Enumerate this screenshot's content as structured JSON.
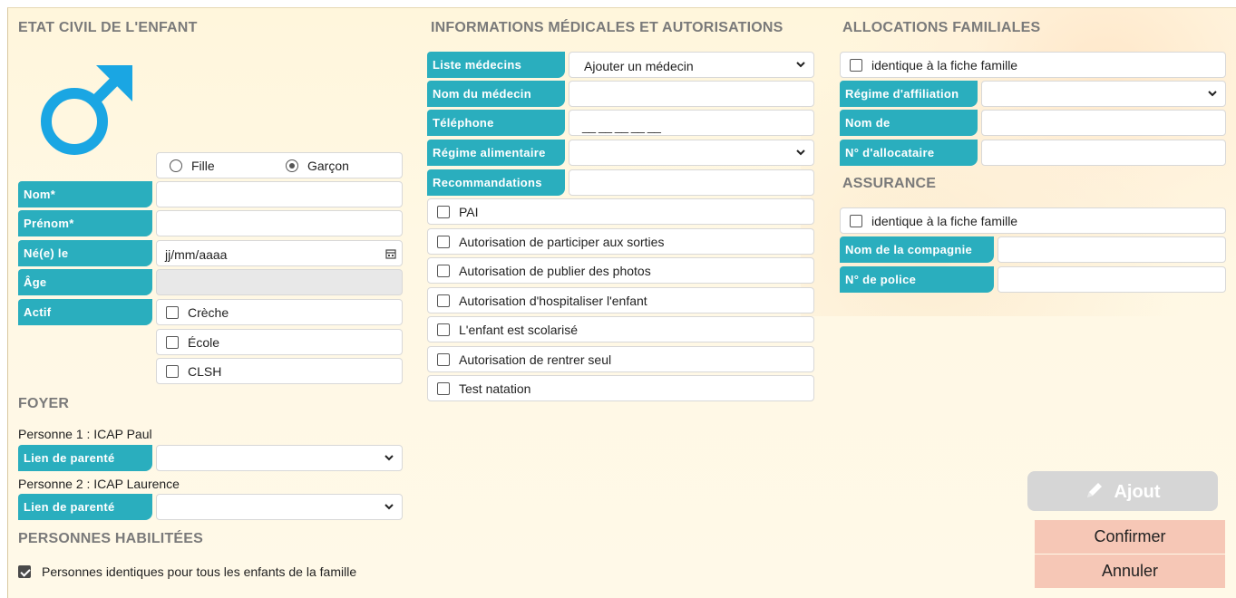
{
  "etat_civil": {
    "title": "ETAT CIVIL DE L'ENFANT",
    "gender_icon": "male-symbol-icon",
    "sexe": {
      "fille_label": "Fille",
      "garcon_label": "Garçon",
      "selected": "garcon"
    },
    "nom_label": "Nom*",
    "prenom_label": "Prénom*",
    "ne_le_label": "Né(e) le",
    "ne_le_placeholder": "jj/mm/aaaa",
    "age_label": "Âge",
    "actif_label": "Actif",
    "creche_label": "Crèche",
    "ecole_label": "École",
    "clsh_label": "CLSH"
  },
  "foyer": {
    "title": "FOYER",
    "personne1": "Personne 1 : ICAP Paul",
    "personne2": "Personne 2 : ICAP Laurence",
    "lien_label_1": "Lien de parenté",
    "lien_label_2": "Lien de parenté"
  },
  "habilitees": {
    "title": "PERSONNES HABILITÉES",
    "identiques_label": "Personnes identiques pour tous les enfants de la famille",
    "identiques_checked": true
  },
  "medical": {
    "title": "INFORMATIONS MÉDICALES ET AUTORISATIONS",
    "liste_medecins_label": "Liste médecins",
    "liste_medecins_value": "Ajouter un médecin",
    "nom_medecin_label": "Nom du médecin",
    "telephone_label": "Téléphone",
    "telephone_mask": "__ __ __ __ __",
    "regime_label": "Régime alimentaire",
    "recommandations_label": "Recommandations",
    "checkboxes": [
      "PAI",
      "Autorisation de participer aux sorties",
      "Autorisation de publier des photos",
      "Autorisation d'hospitaliser l'enfant",
      "L'enfant est scolarisé",
      "Autorisation de rentrer seul",
      "Test natation"
    ]
  },
  "allocations": {
    "title": "ALLOCATIONS FAMILIALES",
    "identique_label": "identique à la fiche famille",
    "regime_label": "Régime d'affiliation",
    "nom_de_label": "Nom de",
    "allocataire_label": "N° d'allocataire"
  },
  "assurance": {
    "title": "ASSURANCE",
    "identique_label": "identique à la fiche famille",
    "compagnie_label": "Nom de la compagnie",
    "police_label": "N° de police"
  },
  "actions": {
    "ajout_label": "Ajout",
    "confirmer_label": "Confirmer",
    "annuler_label": "Annuler",
    "colors": {
      "ajout_bg": "#d6d6d6",
      "confirm_bg": "#f6c7b6",
      "label_bg": "#2aaebe"
    }
  }
}
